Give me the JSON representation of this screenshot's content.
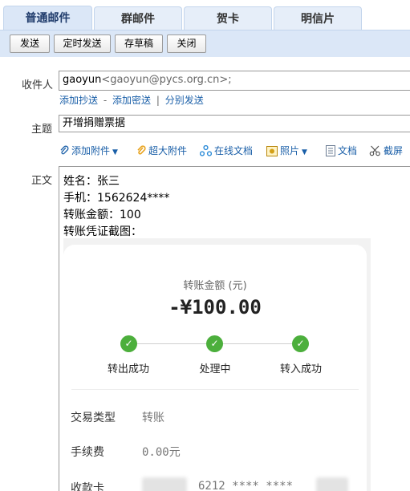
{
  "tabs": [
    {
      "label": "普通邮件",
      "active": true
    },
    {
      "label": "群邮件",
      "active": false
    },
    {
      "label": "贺卡",
      "active": false
    },
    {
      "label": "明信片",
      "active": false
    }
  ],
  "toolbar": {
    "send": "发送",
    "timed_send": "定时发送",
    "save_draft": "存草稿",
    "close": "关闭"
  },
  "form": {
    "to_label": "收件人",
    "to_name": "gaoyun",
    "to_address": "<gaoyun@pycs.org.cn>;",
    "add_cc": "添加抄送",
    "dash": "-",
    "add_bcc": "添加密送",
    "pipe": "|",
    "separate_send": "分别发送",
    "subject_label": "主题",
    "subject_value": "开增捐赠票据",
    "body_label": "正文"
  },
  "attach_bar": {
    "add_attachment": "添加附件",
    "large_attachment": "超大附件",
    "online_doc": "在线文档",
    "photo": "照片",
    "document": "文档",
    "screenshot": "截屏"
  },
  "body": {
    "lines": [
      "姓名：张三",
      "手机：1562624****",
      "转账金额：100",
      "转账凭证截图："
    ]
  },
  "receipt": {
    "label": "转账金额 (元)",
    "amount": "-¥100.00",
    "steps": [
      "转出成功",
      "处理中",
      "转入成功"
    ],
    "rows": [
      {
        "key": "交易类型",
        "value": "转账"
      },
      {
        "key": "手续费",
        "value": "0.00元"
      },
      {
        "key": "收款卡",
        "value": "6212 **** ****"
      }
    ]
  },
  "colors": {
    "accent_blue": "#1a5fa8",
    "tab_bg": "#dbe7f7",
    "success_green": "#4caf3c"
  }
}
